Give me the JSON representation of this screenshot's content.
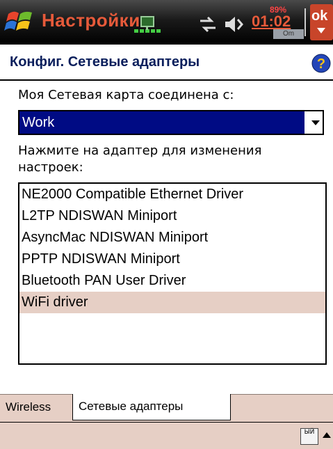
{
  "titlebar": {
    "title": "Настройки",
    "battery": "89%",
    "time": "01:02",
    "clock_sub": "Om",
    "ok_label": "ok"
  },
  "header": {
    "title": "Конфиг. Сетевые адаптеры"
  },
  "main": {
    "combo_label": "Моя Сетевая карта соединена с:",
    "combo_value": "Work",
    "list_label_line1": "Нажмите на адаптер для изменения",
    "list_label_line2": "настроек:",
    "adapters": [
      "NE2000 Compatible Ethernet Driver",
      "L2TP NDISWAN Miniport",
      "AsyncMac NDISWAN Miniport",
      "PPTP NDISWAN Miniport",
      "Bluetooth PAN User Driver",
      "WiFi driver"
    ],
    "selected_index": 5
  },
  "tabs": [
    {
      "label": "Wireless"
    },
    {
      "label": "Сетевые адаптеры"
    }
  ],
  "bottombar": {
    "kbd_icon": "keyboard-icon",
    "kbd_text": "ЫЙ"
  },
  "colors": {
    "titlebar_text": "#e65a3a",
    "combo_highlight": "#000b84",
    "selection": "#e6cfc5"
  }
}
